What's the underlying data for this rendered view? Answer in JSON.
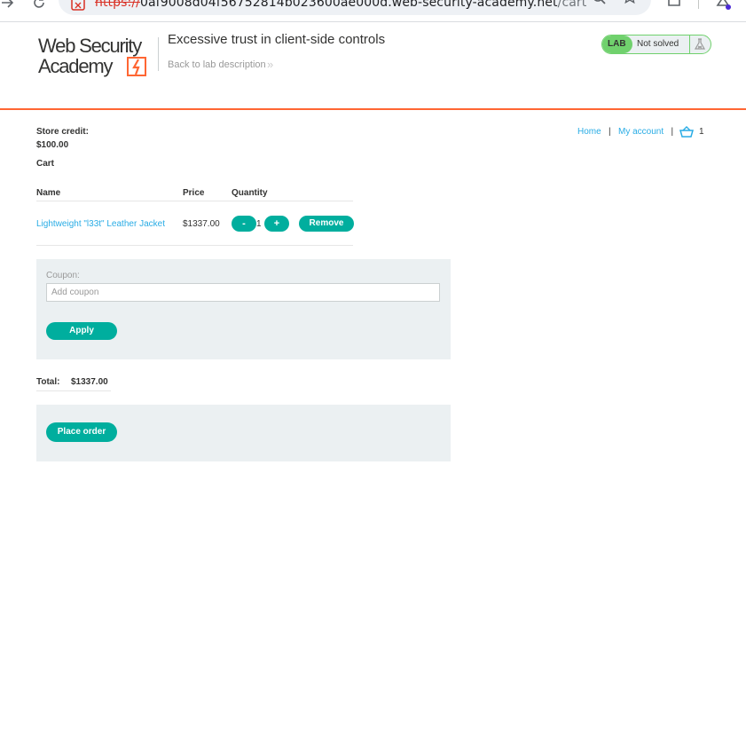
{
  "browser": {
    "url_scheme": "https://",
    "url_host": "0af9008d04f56752814b023600ae000d.web-security-academy.net",
    "url_path": "/cart"
  },
  "lab": {
    "logo_line1": "Web Security",
    "logo_line2": "Academy",
    "title": "Excessive trust in client-side controls",
    "back_link": "Back to lab description",
    "badge": "LAB",
    "status": "Not solved"
  },
  "account": {
    "store_credit_label": "Store credit:",
    "store_credit_value": "$100.00"
  },
  "nav": {
    "home": "Home",
    "separator": "|",
    "my_account": "My account",
    "cart_count": "1"
  },
  "cart": {
    "heading": "Cart",
    "columns": [
      "Name",
      "Price",
      "Quantity"
    ],
    "items": [
      {
        "name": "Lightweight \"l33t\" Leather Jacket",
        "price": "$1337.00",
        "decrement_label": "-",
        "quantity": "1",
        "increment_label": "+",
        "remove_label": "Remove"
      }
    ]
  },
  "coupon": {
    "label": "Coupon:",
    "placeholder": "Add coupon",
    "apply_label": "Apply"
  },
  "totals": {
    "label": "Total:",
    "value": "$1337.00"
  },
  "order": {
    "place_order_label": "Place order"
  },
  "colors": {
    "accent": "#00ae9e",
    "link": "#29ace5",
    "header_rule": "#ff6633",
    "lab_badge": "#70d16d",
    "panel": "#ebf0f2"
  }
}
